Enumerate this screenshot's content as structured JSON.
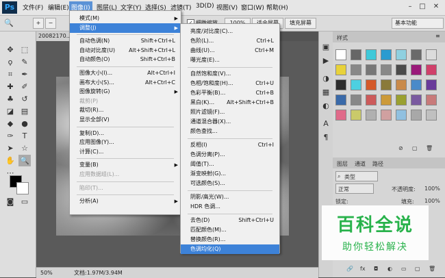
{
  "app": {
    "logo": "Ps"
  },
  "menubar": {
    "items": [
      "文件(F)",
      "编辑(E)",
      "图像(I)",
      "图层(L)",
      "文字(Y)",
      "选择(S)",
      "滤镜(T)",
      "3D(D)",
      "视图(V)",
      "窗口(W)",
      "帮助(H)"
    ],
    "active_index": 2,
    "window_controls": [
      "–",
      "□",
      "✕"
    ]
  },
  "options_bar": {
    "zoom_mode_icons": [
      "zoom-in-icon",
      "zoom-out-icon"
    ],
    "resize_windows_label": "调整窗口大小以满屏显示",
    "zoom_all_label": "缩放所有窗口",
    "scrubby_zoom_label": "细微缩放",
    "scrubby_zoom_checked": true,
    "btn_100": "100%",
    "btn_fit": "适合屏幕",
    "btn_fill": "填充屏幕",
    "workspace": "基本功能"
  },
  "document": {
    "tab_label": "20082170...",
    "status_zoom": "50%",
    "status_doc": "文档:1.97M/3.94M"
  },
  "image_menu": {
    "items": [
      {
        "label": "模式(M)",
        "shortcut": "",
        "submenu": true,
        "disabled": false
      },
      {
        "label": "调整(J)",
        "shortcut": "",
        "submenu": true,
        "disabled": false,
        "highlighted": true
      },
      {
        "sep": true
      },
      {
        "label": "自动色调(N)",
        "shortcut": "Shift+Ctrl+L",
        "submenu": false,
        "disabled": false
      },
      {
        "label": "自动对比度(U)",
        "shortcut": "Alt+Shift+Ctrl+L",
        "submenu": false,
        "disabled": false
      },
      {
        "label": "自动颜色(O)",
        "shortcut": "Shift+Ctrl+B",
        "submenu": false,
        "disabled": false
      },
      {
        "sep": true
      },
      {
        "label": "图像大小(I)...",
        "shortcut": "Alt+Ctrl+I",
        "submenu": false,
        "disabled": false
      },
      {
        "label": "画布大小(S)...",
        "shortcut": "Alt+Ctrl+C",
        "submenu": false,
        "disabled": false
      },
      {
        "label": "图像旋转(G)",
        "shortcut": "",
        "submenu": true,
        "disabled": false
      },
      {
        "label": "裁剪(P)",
        "shortcut": "",
        "submenu": false,
        "disabled": true
      },
      {
        "label": "裁切(R)...",
        "shortcut": "",
        "submenu": false,
        "disabled": false
      },
      {
        "label": "显示全部(V)",
        "shortcut": "",
        "submenu": false,
        "disabled": false
      },
      {
        "sep": true
      },
      {
        "label": "复制(D)...",
        "shortcut": "",
        "submenu": false,
        "disabled": false
      },
      {
        "label": "应用图像(Y)...",
        "shortcut": "",
        "submenu": false,
        "disabled": false
      },
      {
        "label": "计算(C)...",
        "shortcut": "",
        "submenu": false,
        "disabled": false
      },
      {
        "sep": true
      },
      {
        "label": "变量(B)",
        "shortcut": "",
        "submenu": true,
        "disabled": false
      },
      {
        "label": "应用数据组(L)...",
        "shortcut": "",
        "submenu": false,
        "disabled": true
      },
      {
        "sep": true
      },
      {
        "label": "陷印(T)...",
        "shortcut": "",
        "submenu": false,
        "disabled": true
      },
      {
        "sep": true
      },
      {
        "label": "分析(A)",
        "shortcut": "",
        "submenu": true,
        "disabled": false
      }
    ]
  },
  "adjust_menu": {
    "items": [
      {
        "label": "亮度/对比度(C)...",
        "shortcut": ""
      },
      {
        "label": "色阶(L)...",
        "shortcut": "Ctrl+L"
      },
      {
        "label": "曲线(U)...",
        "shortcut": "Ctrl+M"
      },
      {
        "label": "曝光度(E)...",
        "shortcut": ""
      },
      {
        "sep": true
      },
      {
        "label": "自然饱和度(V)...",
        "shortcut": ""
      },
      {
        "label": "色相/饱和度(H)...",
        "shortcut": "Ctrl+U"
      },
      {
        "label": "色彩平衡(B)...",
        "shortcut": "Ctrl+B"
      },
      {
        "label": "黑白(K)...",
        "shortcut": "Alt+Shift+Ctrl+B"
      },
      {
        "label": "照片滤镜(F)...",
        "shortcut": ""
      },
      {
        "label": "通道混合器(X)...",
        "shortcut": ""
      },
      {
        "label": "颜色查找...",
        "shortcut": ""
      },
      {
        "sep": true
      },
      {
        "label": "反相(I)",
        "shortcut": "Ctrl+I"
      },
      {
        "label": "色调分离(P)...",
        "shortcut": ""
      },
      {
        "label": "阈值(T)...",
        "shortcut": ""
      },
      {
        "label": "渐变映射(G)...",
        "shortcut": ""
      },
      {
        "label": "可选颜色(S)...",
        "shortcut": ""
      },
      {
        "sep": true
      },
      {
        "label": "阴影/高光(W)...",
        "shortcut": ""
      },
      {
        "label": "HDR 色调...",
        "shortcut": ""
      },
      {
        "sep": true
      },
      {
        "label": "去色(D)",
        "shortcut": "Shift+Ctrl+U"
      },
      {
        "label": "匹配颜色(M)...",
        "shortcut": ""
      },
      {
        "label": "替换颜色(R)...",
        "shortcut": ""
      },
      {
        "label": "色调均化(Q)",
        "shortcut": "",
        "highlighted": true
      }
    ]
  },
  "styles_panel": {
    "tab": "样式",
    "swatch_colors": [
      "#ffffff",
      "#666666",
      "#3fc9d9",
      "#2a9bd0",
      "#8fd0e0",
      "#6a6a6a",
      "#dcdcdc",
      "#e8d23a",
      "#888888",
      "#777777",
      "#888888",
      "#4b4b4b",
      "#9a1a7a",
      "#d0406a",
      "#2d2d2d",
      "#4dd0e0",
      "#d45a2a",
      "#8a7a3a",
      "#c98a4a",
      "#4a8ac9",
      "#6a3a9a",
      "#3a6aa9",
      "#888888",
      "#cc5a5a",
      "#cc9a3a",
      "#9aa030",
      "#7a5aa0",
      "#c87a7a",
      "#e06a8a",
      "#caca6a",
      "#b0b0b0",
      "#d0a0a0",
      "#90c0e0",
      "#a8a8a8",
      "#c0c0c0"
    ]
  },
  "layers_panel": {
    "tabs": [
      "图层",
      "通道",
      "路径"
    ],
    "filter_label": "类型",
    "blend_mode": "正常",
    "opacity_label": "不透明度:",
    "opacity_value": "100%",
    "lock_label": "锁定:",
    "fill_label": "填充:",
    "fill_value": "100%"
  },
  "watermark": {
    "title": "百科全说",
    "subtitle": "助你轻松解决"
  },
  "colors": {
    "menu_highlight": "#3d82d8",
    "watermark_green": "#28b24b"
  }
}
